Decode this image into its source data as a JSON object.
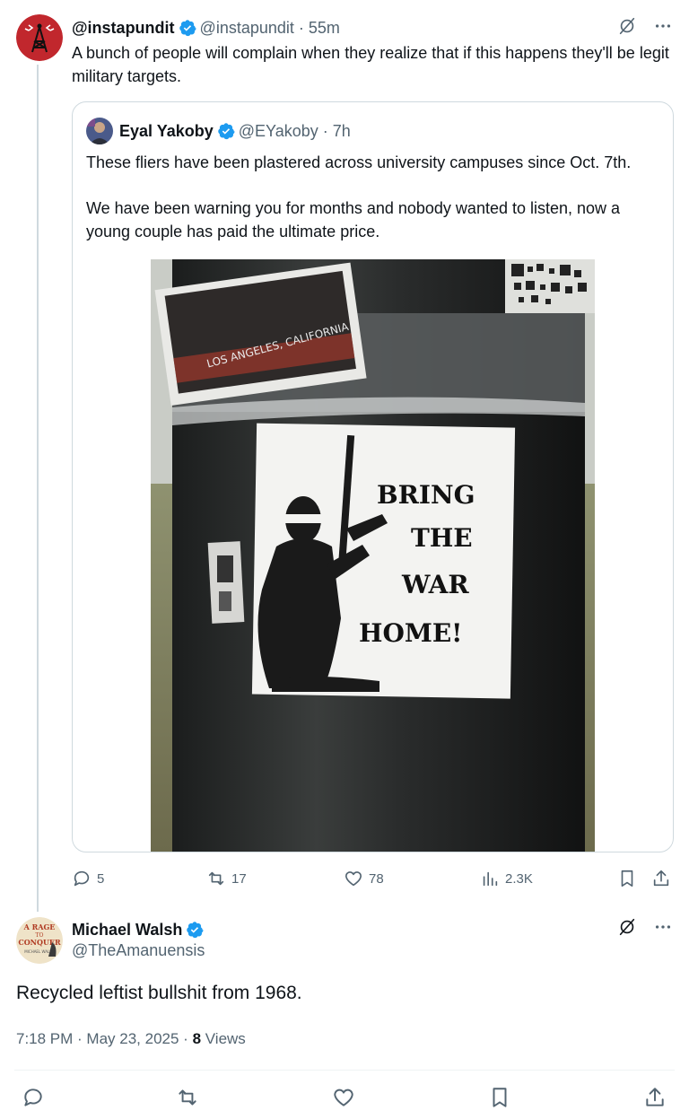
{
  "tweet": {
    "display_name": "@instapundit",
    "handle": "@instapundit",
    "time": "· 55m",
    "text": "A bunch of people will complain when they realize that if this happens they'll be legit military targets."
  },
  "quote": {
    "display_name": "Eyal Yakoby",
    "handle": "@EYakoby",
    "time": "· 7h",
    "paragraph1": "These fliers have been plastered across university campuses since Oct. 7th.",
    "paragraph2": "We have been warning you for months and nobody wanted to listen, now a young couple has paid the ultimate price.",
    "image": {
      "top_sticker_text": "LOS ANGELES, CALIFORNIA",
      "poster_line1": "BRING",
      "poster_line2": "THE",
      "poster_line3": "WAR",
      "poster_line4": "HOME!"
    }
  },
  "engagement": {
    "replies": "5",
    "reposts": "17",
    "likes": "78",
    "views": "2.3K"
  },
  "reply": {
    "display_name": "Michael Walsh",
    "handle": "@TheAmanuensis",
    "avatar_text1": "A RAGE",
    "avatar_text2": "TO",
    "avatar_text3": "CONQUER",
    "avatar_text4": "MICHAEL WALSH",
    "text": "Recycled leftist bullshit from 1968.",
    "time": "7:18 PM · May 23, 2025 ·",
    "views_count": "8",
    "views_label": "Views"
  },
  "colors": {
    "verified": "#1d9bf0",
    "muted": "#536471",
    "avatar_red": "#c1272d"
  }
}
